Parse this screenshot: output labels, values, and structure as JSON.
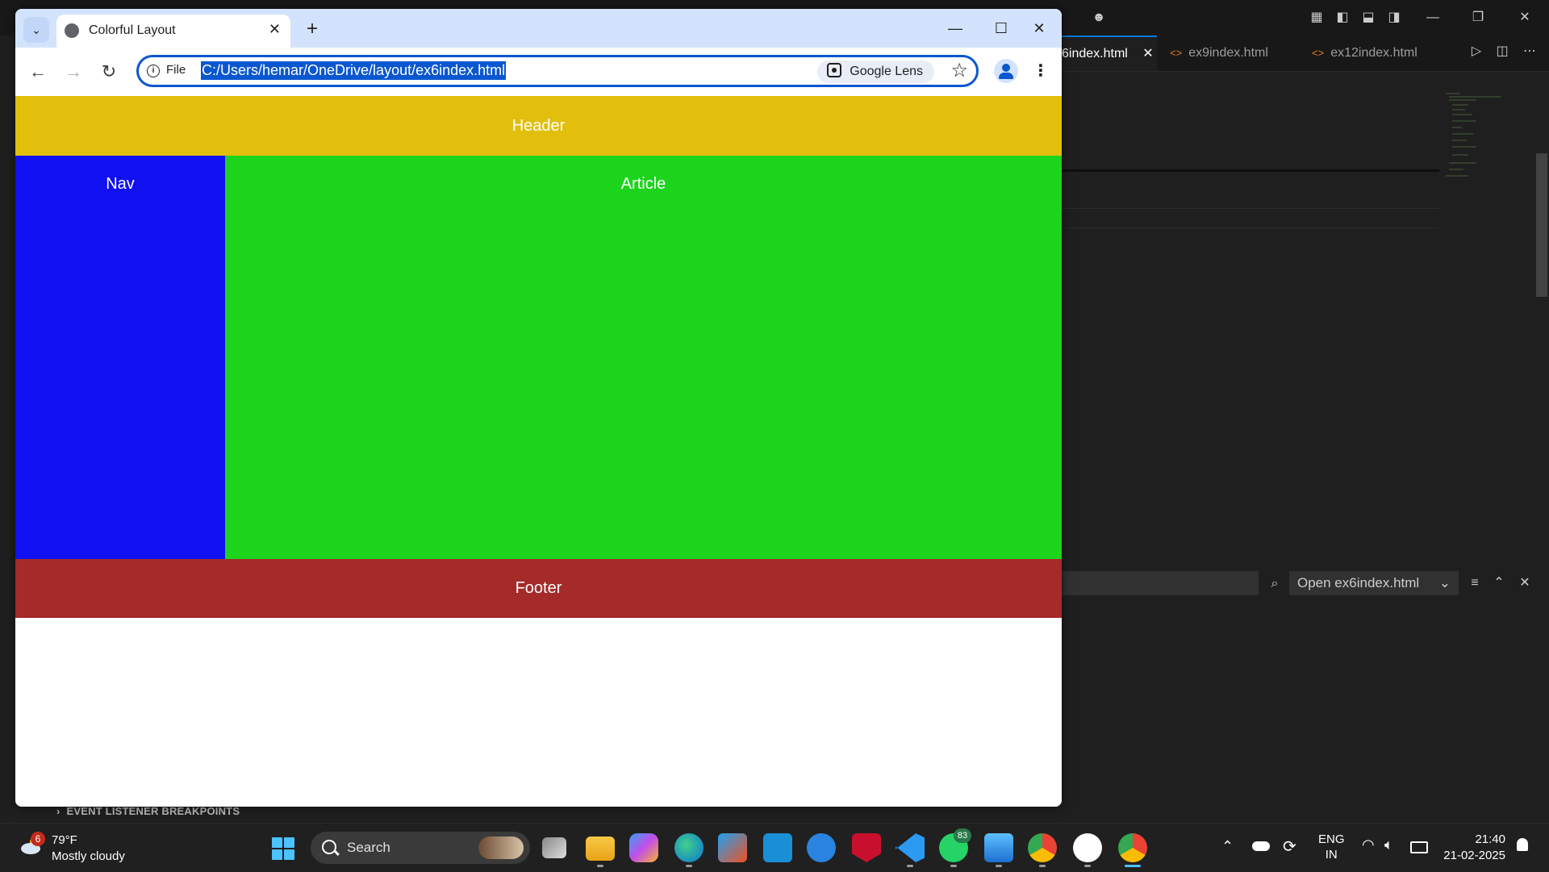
{
  "vscode": {
    "tabs": [
      {
        "label": "6index.html",
        "active": true
      },
      {
        "label": "ex9index.html",
        "active": false
      },
      {
        "label": "ex12index.html",
        "active": false
      }
    ],
    "panel_dropdown": "Open ex6index.html",
    "section_label": "EVENT LISTENER BREAKPOINTS"
  },
  "browser": {
    "tab_title": "Colorful Layout",
    "scheme_chip": "File",
    "url": "C:/Users/hemar/OneDrive/layout/ex6index.html",
    "lens_label": "Google Lens"
  },
  "page": {
    "header": {
      "label": "Header",
      "color": "#e1bf0c"
    },
    "nav": {
      "label": "Nav",
      "color": "#1010f0"
    },
    "article": {
      "label": "Article",
      "color": "#1cd41c"
    },
    "footer": {
      "label": "Footer",
      "color": "#a52a2a"
    }
  },
  "taskbar": {
    "weather_badge": "6",
    "weather_temp": "79°F",
    "weather_desc": "Mostly cloudy",
    "search_label": "Search",
    "whatsapp_badge": "83",
    "lang_line1": "ENG",
    "lang_line2": "IN",
    "time": "21:40",
    "date": "21-02-2025"
  }
}
